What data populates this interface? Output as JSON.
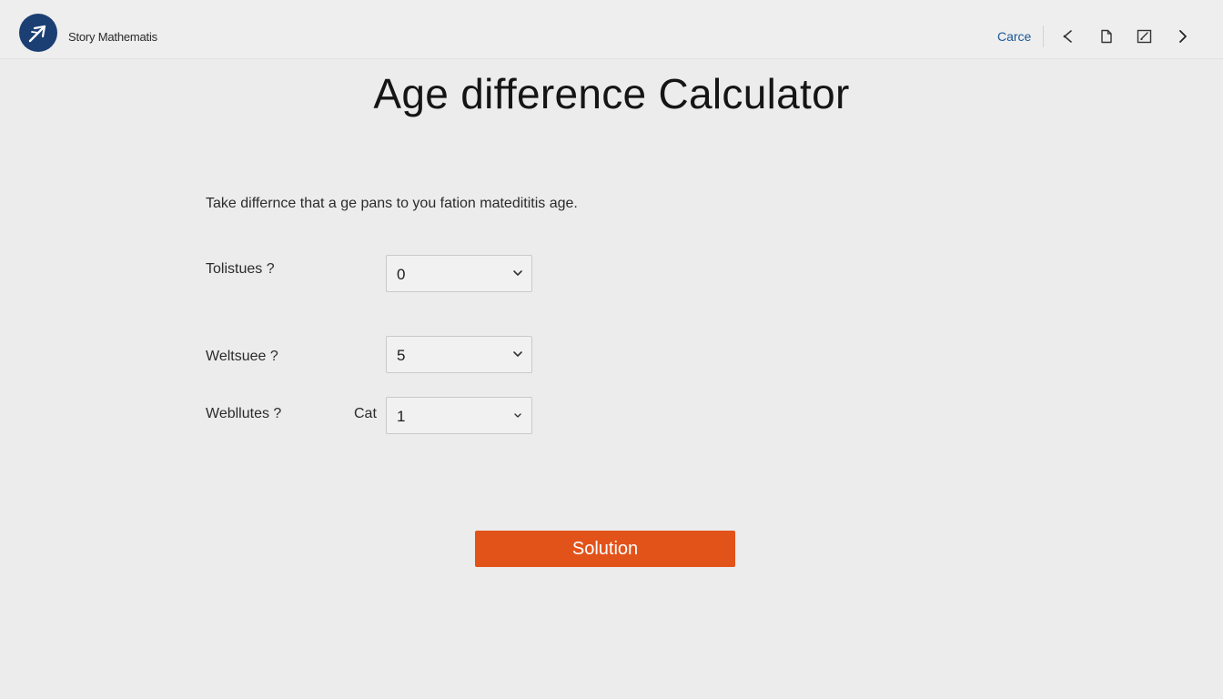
{
  "header": {
    "brand": "Story Mathematis",
    "cancel_label": "Carce",
    "icons": [
      "share-icon",
      "document-icon",
      "edit-icon",
      "chevron-right-icon"
    ]
  },
  "main": {
    "title": "Age difference Calculator",
    "instruction": "Take differnce that a ge pans to you fation matedititis age.",
    "fields": [
      {
        "label": "Tolistues ?",
        "unit": "",
        "value": "0"
      },
      {
        "label": "Weltsuee ?",
        "unit": "",
        "value": "5"
      },
      {
        "label": "Webllutes ?",
        "unit": "Cat",
        "value": "1"
      }
    ],
    "solution_label": "Solution"
  },
  "colors": {
    "accent": "#e2531a",
    "brand": "#1b3f73",
    "link": "#1a5796",
    "background": "#ececec"
  }
}
